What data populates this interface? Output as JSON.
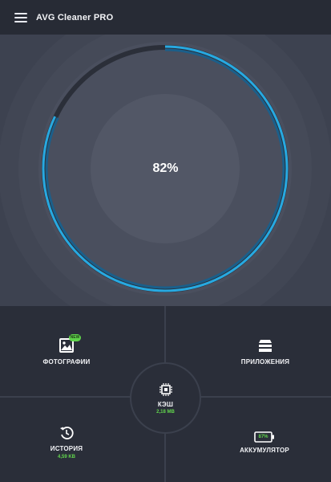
{
  "app": {
    "title": "AVG Cleaner PRO"
  },
  "icons": {
    "menu": "menu-icon",
    "photos": "image-icon",
    "apps": "apps-stack-icon",
    "cache": "chip-icon",
    "history": "history-icon",
    "battery": "battery-icon"
  },
  "colors": {
    "accent": "#27a9e1",
    "status_green": "#5ed34a",
    "track": "#2b2f39",
    "background": "#3d4250",
    "panel": "#2a2e39"
  },
  "gauge": {
    "percent_label": "82%",
    "fraction": 0.82
  },
  "tiles": {
    "photos": {
      "label": "ФОТОГРАФИИ",
      "badge": "NEW"
    },
    "apps": {
      "label": "ПРИЛОЖЕНИЯ"
    },
    "cache": {
      "label": "КЭШ",
      "size": "2,18 MB"
    },
    "history": {
      "label": "ИСТОРИЯ",
      "size": "4,59 KB"
    },
    "battery": {
      "label": "АККУМУЛЯТОР",
      "level": "87%"
    }
  }
}
